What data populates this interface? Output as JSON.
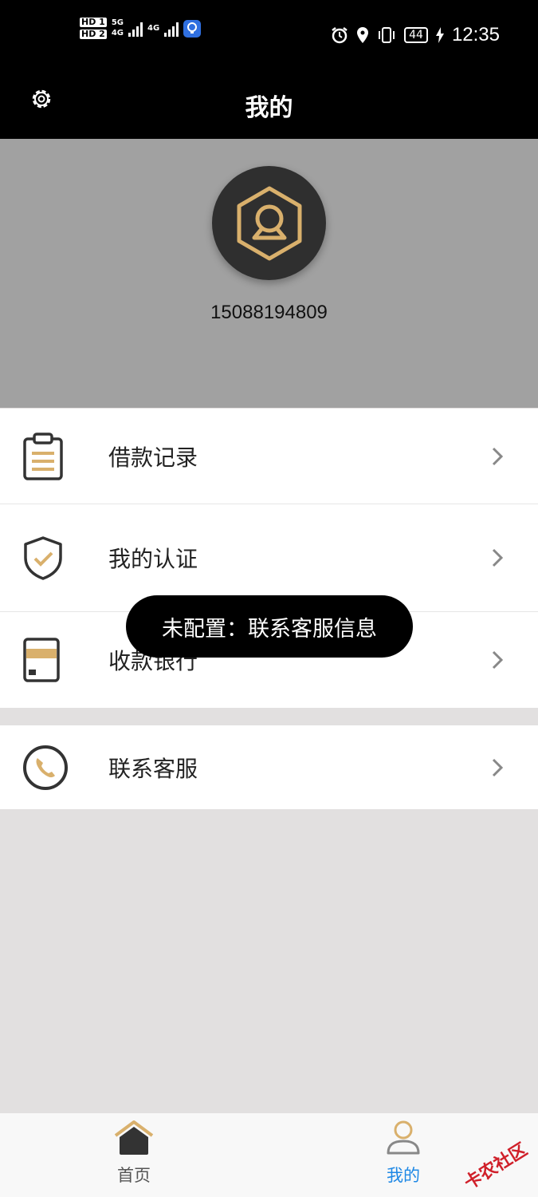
{
  "status_bar": {
    "sim1": "HD 1",
    "sim2": "HD 2",
    "net1": "5G",
    "net1b": "4G",
    "net2": "4G",
    "battery": "44",
    "time": "12:35"
  },
  "header": {
    "title": "我的"
  },
  "profile": {
    "phone": "15088194809"
  },
  "menu_group1": [
    {
      "label": "借款记录"
    },
    {
      "label": "我的认证"
    },
    {
      "label": "收款银行"
    }
  ],
  "menu_group2": [
    {
      "label": "联系客服"
    }
  ],
  "toast": {
    "text": "未配置：联系客服信息"
  },
  "tabbar": {
    "home_label": "首页",
    "mine_label": "我的",
    "active_color": "#1e88e5",
    "inactive_color": "#555555"
  },
  "watermark": {
    "text": "卡农社区"
  },
  "colors": {
    "accent_gold": "#d9b06c",
    "dark": "#333333"
  }
}
